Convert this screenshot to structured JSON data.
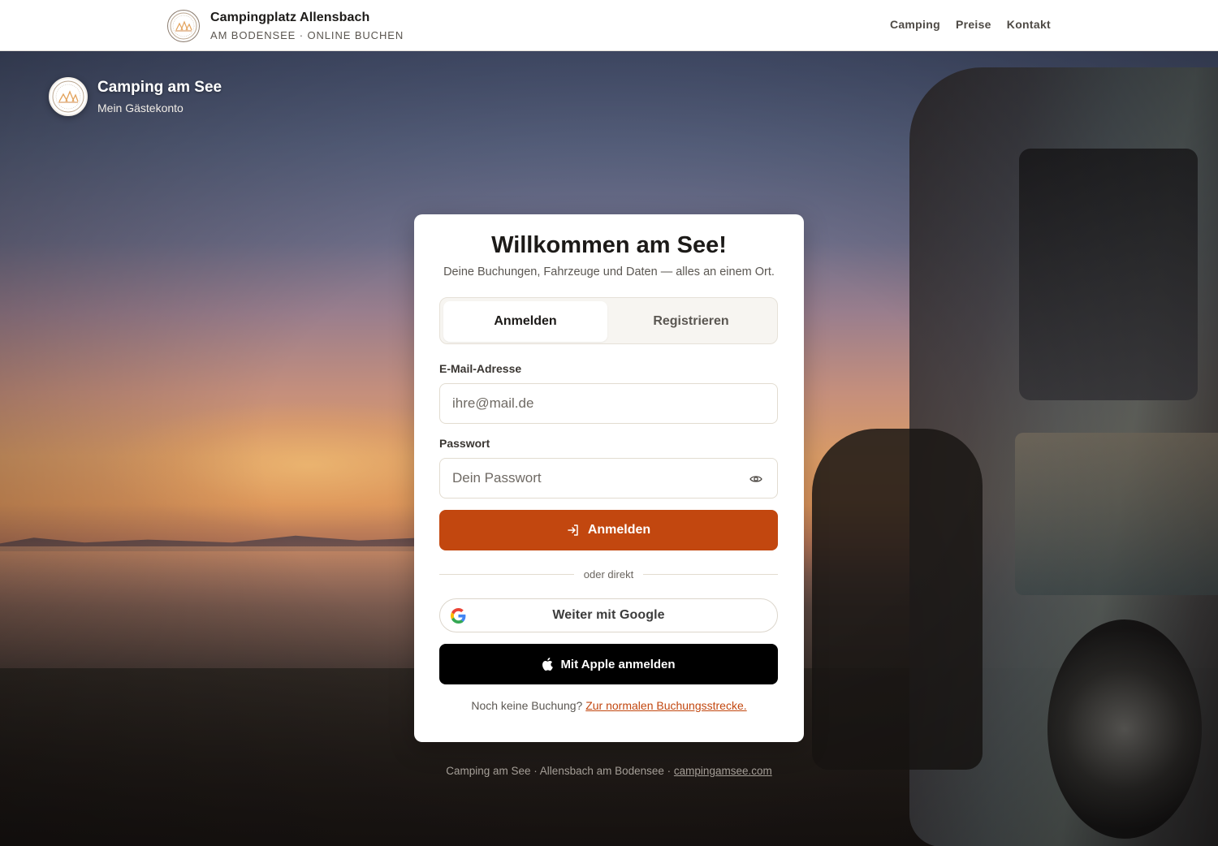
{
  "header": {
    "brand_title": "Campingplatz Allensbach",
    "brand_subtitle": "AM BODENSEE · ONLINE BUCHEN",
    "nav": [
      {
        "label": "Camping"
      },
      {
        "label": "Preise"
      },
      {
        "label": "Kontakt"
      }
    ]
  },
  "site_badge": {
    "title": "Camping am See",
    "subtitle": "Mein Gästekonto"
  },
  "login_card": {
    "title": "Willkommen am See!",
    "subtitle": "Deine Buchungen, Fahrzeuge und Daten — alles an einem Ort.",
    "tabs": [
      {
        "label": "Anmelden",
        "active": true
      },
      {
        "label": "Registrieren",
        "active": false
      }
    ],
    "email_label": "E-Mail-Adresse",
    "email_placeholder": "ihre@mail.de",
    "email_value": "",
    "password_label": "Passwort",
    "password_placeholder": "Dein Passwort",
    "password_value": "",
    "submit_label": "Anmelden",
    "divider_text": "oder direkt",
    "google_label": "Weiter mit Google",
    "apple_label": "Mit Apple anmelden",
    "note_text": "Noch keine Buchung?",
    "note_link": "Zur normalen Buchungsstrecke."
  },
  "footer": {
    "text": "Camping am See · Allensbach am Bodensee ·",
    "link": "campingamsee.com"
  },
  "colors": {
    "accent": "#c2470f",
    "apple_button": "#000000",
    "card_bg": "#ffffff"
  },
  "icons": {
    "password_toggle": "eye-icon",
    "submit": "login-arrow-icon",
    "google": "google-g-icon",
    "apple": "apple-icon"
  }
}
